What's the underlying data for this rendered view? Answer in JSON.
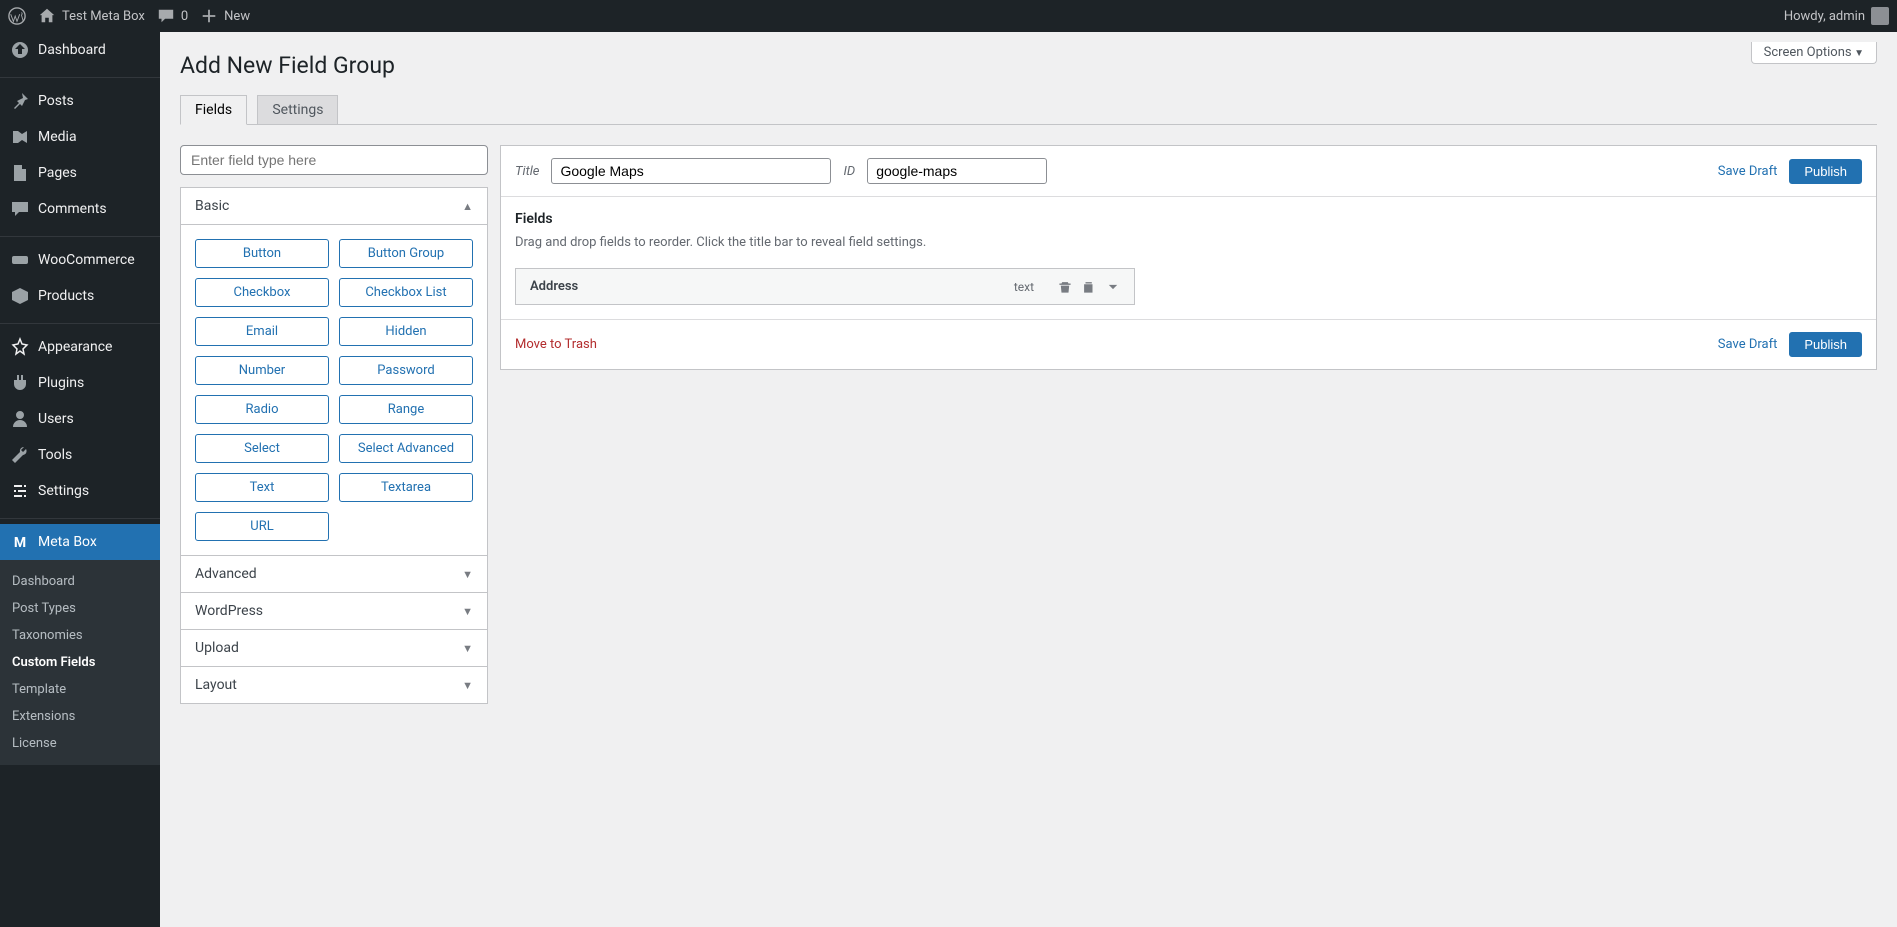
{
  "adminbar": {
    "site_name": "Test Meta Box",
    "comments_count": "0",
    "new_label": "New",
    "howdy": "Howdy, admin"
  },
  "sidebar": {
    "items": [
      {
        "label": "Dashboard",
        "icon": "dashboard"
      },
      {
        "sep": true
      },
      {
        "label": "Posts",
        "icon": "pin"
      },
      {
        "label": "Media",
        "icon": "media"
      },
      {
        "label": "Pages",
        "icon": "page"
      },
      {
        "label": "Comments",
        "icon": "comment"
      },
      {
        "sep": true
      },
      {
        "label": "WooCommerce",
        "icon": "woo"
      },
      {
        "label": "Products",
        "icon": "products"
      },
      {
        "sep": true
      },
      {
        "label": "Appearance",
        "icon": "appearance"
      },
      {
        "label": "Plugins",
        "icon": "plugin"
      },
      {
        "label": "Users",
        "icon": "user"
      },
      {
        "label": "Tools",
        "icon": "tools"
      },
      {
        "label": "Settings",
        "icon": "settings"
      },
      {
        "sep": true
      },
      {
        "label": "Meta Box",
        "icon": "metabox",
        "current": true
      }
    ],
    "submenu": [
      {
        "label": "Dashboard"
      },
      {
        "label": "Post Types"
      },
      {
        "label": "Taxonomies"
      },
      {
        "label": "Custom Fields",
        "current": true
      },
      {
        "label": "Template"
      },
      {
        "label": "Extensions"
      },
      {
        "label": "License"
      }
    ]
  },
  "header": {
    "screen_options": "Screen Options",
    "page_title": "Add New Field Group"
  },
  "tabs": {
    "fields": "Fields",
    "settings": "Settings"
  },
  "filter": {
    "placeholder": "Enter field type here"
  },
  "groups": {
    "basic": {
      "title": "Basic",
      "types": [
        "Button",
        "Button Group",
        "Checkbox",
        "Checkbox List",
        "Email",
        "Hidden",
        "Number",
        "Password",
        "Radio",
        "Range",
        "Select",
        "Select Advanced",
        "Text",
        "Textarea",
        "URL"
      ]
    },
    "advanced": {
      "title": "Advanced"
    },
    "wordpress": {
      "title": "WordPress"
    },
    "upload": {
      "title": "Upload"
    },
    "layout": {
      "title": "Layout"
    }
  },
  "editor": {
    "title_label": "Title",
    "title_value": "Google Maps",
    "id_label": "ID",
    "id_value": "google-maps",
    "save_draft": "Save Draft",
    "publish": "Publish",
    "section_title": "Fields",
    "hint": "Drag and drop fields to reorder. Click the title bar to reveal field settings.",
    "field": {
      "name": "Address",
      "type": "text"
    },
    "move_trash": "Move to Trash"
  }
}
